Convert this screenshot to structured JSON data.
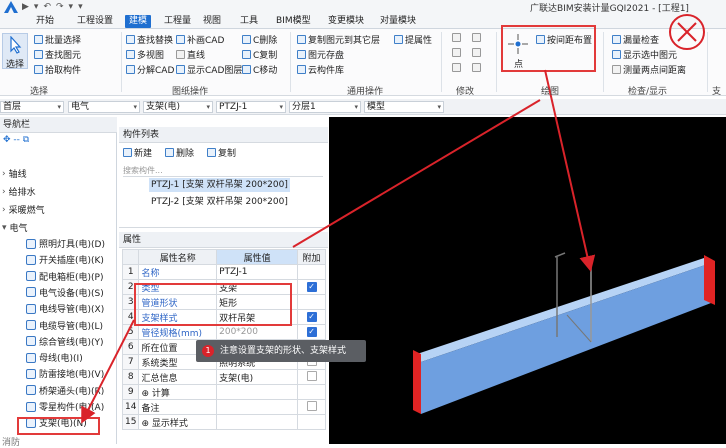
{
  "app": {
    "title": "广联达BIM安装计量GQI2021 - [工程1]"
  },
  "quick_access": [
    "▶",
    "▾",
    "↶",
    "↷",
    "▾",
    "▾"
  ],
  "tabs": [
    "开始",
    "工程设置",
    "建模",
    "工程量",
    "视图",
    "工具",
    "BIM模型",
    "变更模块",
    "对量模块"
  ],
  "active_tab": "建模",
  "ribbon": {
    "select_label": "选择",
    "group1": {
      "items": [
        "批量选择",
        "查找图元",
        "拾取构件"
      ],
      "label": "选择"
    },
    "group2": {
      "col1": [
        "查找替换",
        "多视图",
        "分解CAD"
      ],
      "col2": [
        "补画CAD",
        "直线",
        "显示CAD图层"
      ],
      "col3": [
        "C删除",
        "C复制",
        "C移动"
      ],
      "label": "图纸操作"
    },
    "group3": {
      "col1": [
        "复制图元到其它层",
        "图元存盘",
        "云构件库"
      ],
      "col2": [
        "提属性"
      ],
      "label": "通用操作"
    },
    "group4": {
      "label": "修改"
    },
    "group5": {
      "btn": "按间距布置",
      "point": "点",
      "label": "绘图"
    },
    "group6": {
      "items": [
        "漏量检查",
        "显示选中图元",
        "测量两点间距离"
      ],
      "label": "检查/显示"
    },
    "group7": {
      "label": "支"
    }
  },
  "dropdowns": [
    "首层",
    "电气",
    "支架(电)",
    "PTZJ-1",
    "分层1",
    "模型"
  ],
  "nav": {
    "header": "导航栏",
    "tree": [
      "轴线",
      "给排水",
      "采暖燃气",
      "电气"
    ],
    "items": [
      "照明灯具(电)(D)",
      "开关插座(电)(K)",
      "配电箱柜(电)(P)",
      "电气设备(电)(S)",
      "电线导管(电)(X)",
      "电缆导管(电)(L)",
      "综合管线(电)(Y)",
      "母线(电)(I)",
      "防雷接地(电)(V)",
      "桥架通头(电)(R)",
      "零星构件(电)(A)",
      "支架(电)(N)"
    ],
    "footer": "消防"
  },
  "component_list": {
    "header": "构件列表",
    "toolbar": [
      "新建",
      "删除",
      "复制"
    ],
    "search_placeholder": "搜索构件...",
    "items": [
      "PTZJ-1 [支架 双杆吊架 200*200]",
      "PTZJ-2 [支架 双杆吊架 200*200]"
    ]
  },
  "properties": {
    "header": "属性",
    "columns": [
      "属性名称",
      "属性值",
      "附加"
    ],
    "rows": [
      {
        "num": "1",
        "name": "名称",
        "value": "PTZJ-1",
        "checked": null,
        "blue": true
      },
      {
        "num": "2",
        "name": "类型",
        "value": "支架",
        "checked": true,
        "blue": true
      },
      {
        "num": "3",
        "name": "管道形状",
        "value": "矩形",
        "checked": null,
        "blue": true
      },
      {
        "num": "4",
        "name": "支架样式",
        "value": "双杆吊架",
        "checked": true,
        "blue": true
      },
      {
        "num": "5",
        "name": "管径规格(mm)",
        "value": "200*200",
        "checked": true,
        "blue": true
      },
      {
        "num": "6",
        "name": "所在位置",
        "value": "",
        "checked": false,
        "blue": false
      },
      {
        "num": "7",
        "name": "系统类型",
        "value": "照明系统",
        "checked": false,
        "blue": false
      },
      {
        "num": "8",
        "name": "汇总信息",
        "value": "支架(电)",
        "checked": false,
        "blue": false
      },
      {
        "num": "9",
        "name": "⊕ 计算",
        "value": "",
        "checked": null,
        "blue": false
      },
      {
        "num": "14",
        "name": "备注",
        "value": "",
        "checked": false,
        "blue": false
      },
      {
        "num": "15",
        "name": "⊕ 显示样式",
        "value": "",
        "checked": null,
        "blue": false
      }
    ]
  },
  "tooltip": {
    "number": "1",
    "text": "注意设置支架的形状、支架样式"
  },
  "colors": {
    "accent": "#1f6fd0",
    "highlight": "#e23a3a",
    "beam_face": "#8ab4e8",
    "beam_end": "#e02424"
  }
}
